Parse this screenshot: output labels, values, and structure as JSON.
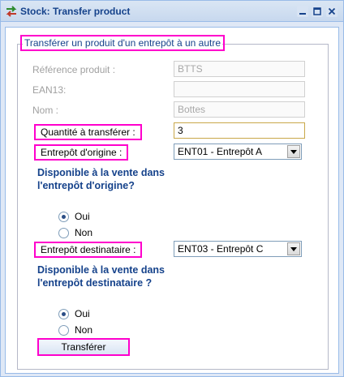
{
  "window": {
    "title": "Stock: Transfer product",
    "tools": [
      "minimize-icon",
      "maximize-icon",
      "close-icon"
    ]
  },
  "form": {
    "legend": "Transférer un produit d'un entrepôt à un autre",
    "reference": {
      "label": "Référence produit :",
      "value": "BTTS",
      "disabled": true
    },
    "ean13": {
      "label": "EAN13:",
      "value": "",
      "disabled": true
    },
    "nom": {
      "label": "Nom :",
      "value": "Bottes",
      "disabled": true
    },
    "quantite": {
      "label": "Quantité à transférer :",
      "value": "3"
    },
    "entrepot_origine": {
      "label": "Entrepôt d'origine :",
      "selected": "ENT01 - Entrepôt A"
    },
    "dispo_origine": {
      "question": "Disponible à la vente dans l'entrepôt d'origine?",
      "options": [
        "Oui",
        "Non"
      ],
      "selected": "Oui"
    },
    "entrepot_destinataire": {
      "label": "Entrepôt destinataire :",
      "selected": "ENT03 - Entrepôt C"
    },
    "dispo_destinataire": {
      "question": "Disponible à la vente dans l'entrepôt destinataire ?",
      "options": [
        "Oui",
        "Non"
      ],
      "selected": "Oui"
    },
    "submit_label": "Transférer"
  },
  "colors": {
    "title_text": "#15428b",
    "highlight": "#ff00cc",
    "panel_bg": "#dfe8f6"
  }
}
